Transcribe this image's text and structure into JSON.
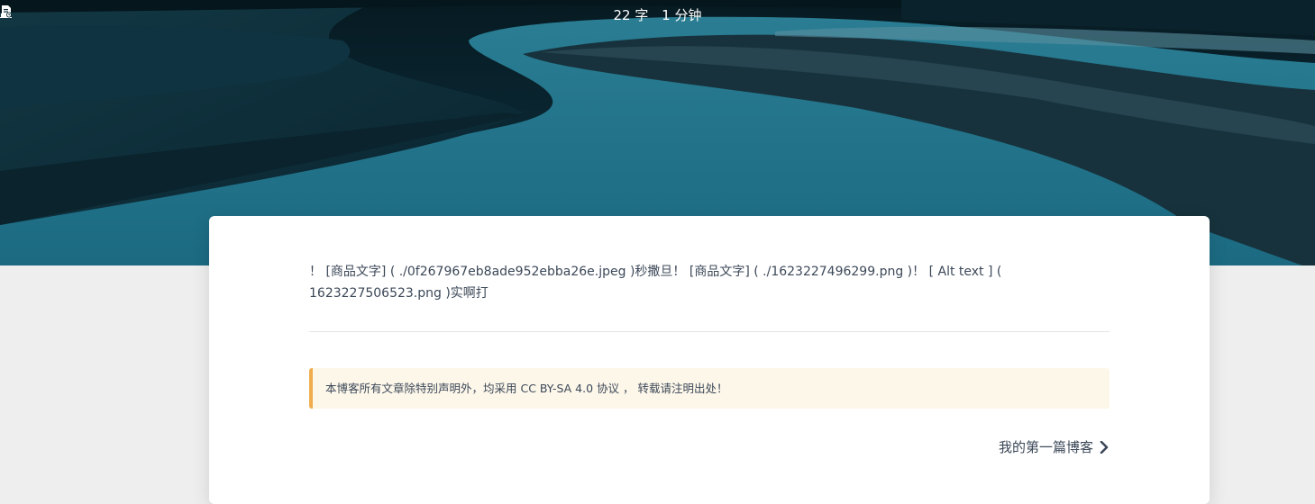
{
  "meta": {
    "words": "22 字",
    "read_time": "1 分钟",
    "words_icon": "chart-bar-icon",
    "time_icon": "document-clock-icon"
  },
  "post": {
    "content": "！ [商品文字] ( ./0f267967eb8ade952ebba26e.jpeg )秒撒旦！ [商品文字] ( ./1623227496299.png )！ [ Alt text ] ( 1623227506523.png )实啊打",
    "license": "本博客所有文章除特别声明外，均采用 CC BY-SA 4.0 协议 ， 转载请注明出处！",
    "next_post": "我的第一篇博客",
    "next_icon": "chevron-right-icon"
  },
  "colors": {
    "page_bg": "#eeeeee",
    "card_bg": "#ffffff",
    "text": "#3c4858",
    "license_bg": "#fdf7ea",
    "license_accent": "#f0ad4e",
    "hero_water": "#1f6f86",
    "hero_land": "#0b2a36"
  }
}
